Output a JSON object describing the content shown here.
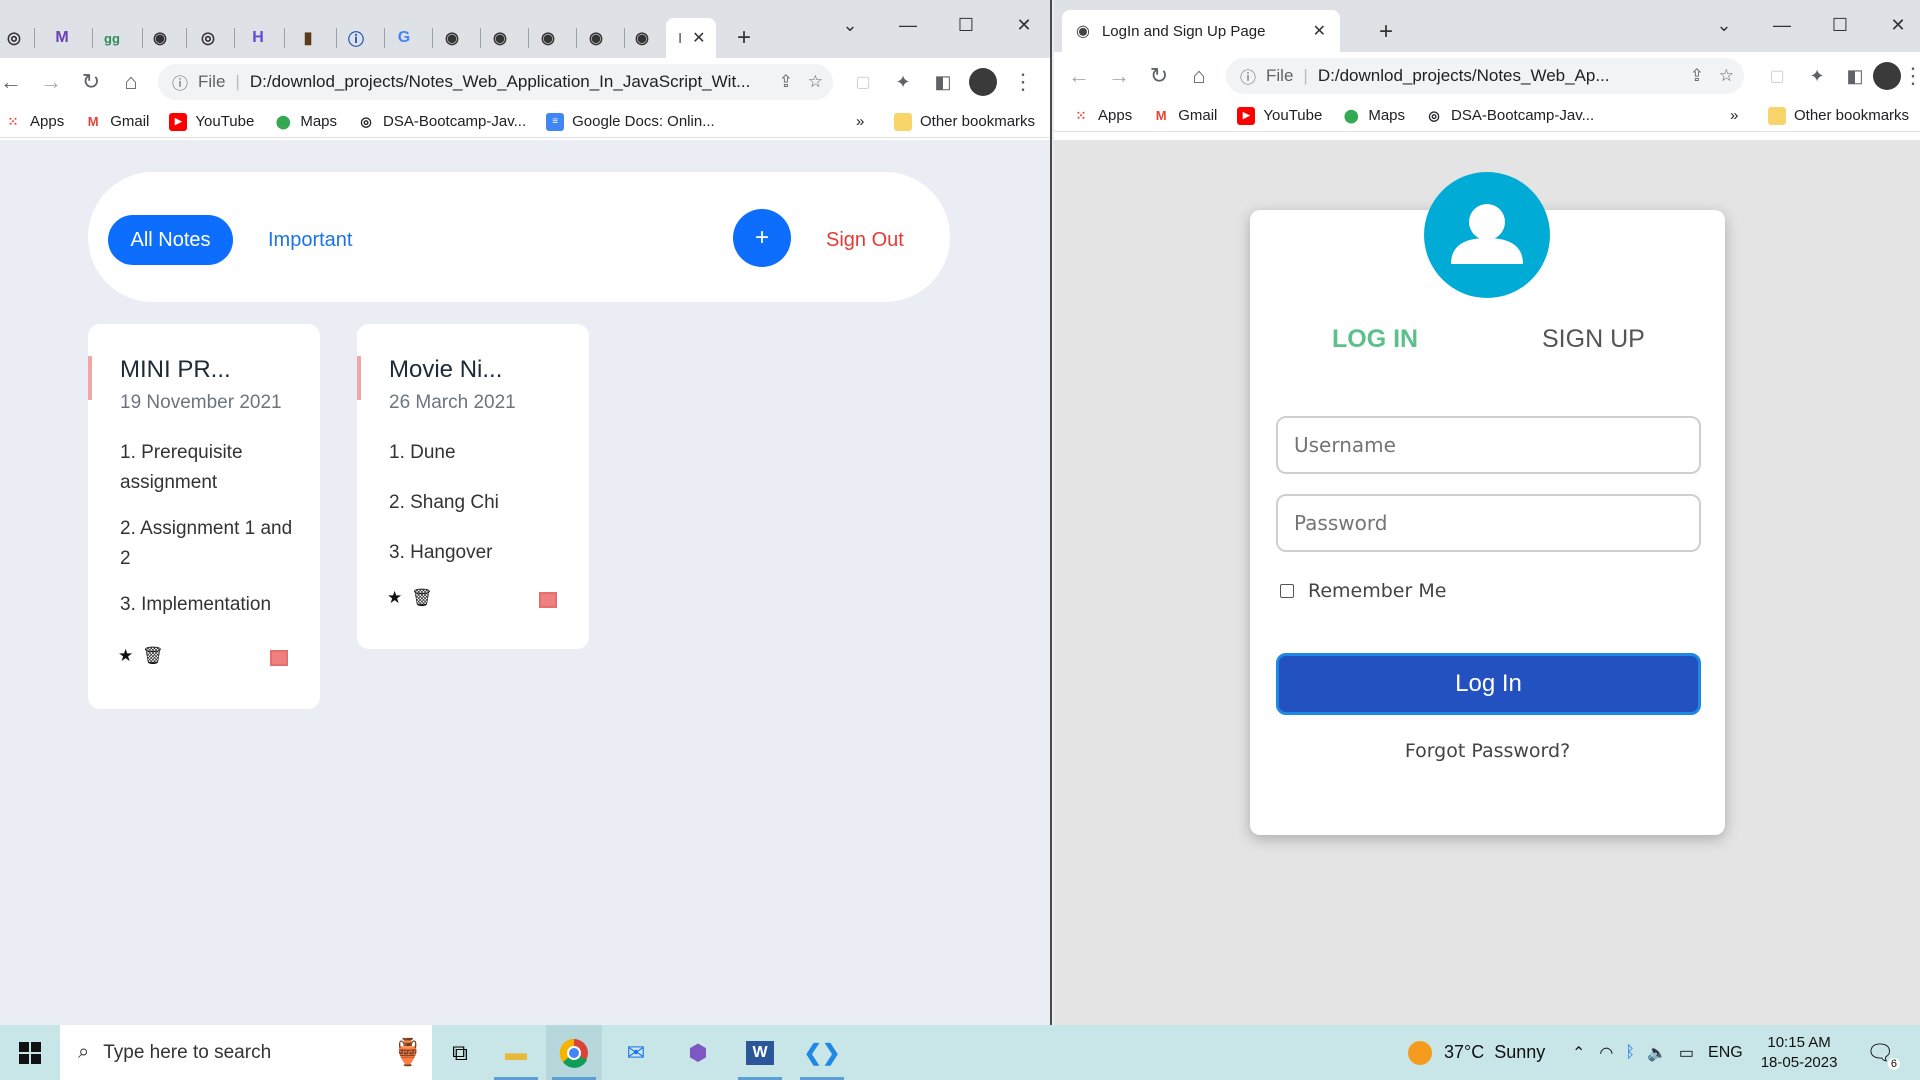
{
  "left_window": {
    "tab_short": "I",
    "address": "D:/downlod_projects/Notes_Web_Application_In_JavaScript_Wit...",
    "file_label": "File",
    "bookmarks": [
      {
        "label": "Apps",
        "icon": "apps-grid-icon"
      },
      {
        "label": "Gmail",
        "icon": "gmail-icon"
      },
      {
        "label": "YouTube",
        "icon": "youtube-icon"
      },
      {
        "label": "Maps",
        "icon": "maps-icon"
      },
      {
        "label": "DSA-Bootcamp-Jav...",
        "icon": "github-icon"
      },
      {
        "label": "Google Docs: Onlin...",
        "icon": "google-docs-icon"
      }
    ],
    "other_bookmarks": "Other bookmarks",
    "more": "»"
  },
  "notes_app": {
    "nav": {
      "all_notes": "All Notes",
      "important": "Important",
      "add": "+",
      "sign_out": "Sign Out"
    },
    "notes": [
      {
        "title": "MINI PR...",
        "date": "19 November 2021",
        "items": [
          "1. Prerequisite assignment",
          "2. Assignment 1 and 2",
          "3. Implementation"
        ]
      },
      {
        "title": "Movie Ni...",
        "date": "26 March 2021",
        "items": [
          "1. Dune",
          "2. Shang Chi",
          "3. Hangover"
        ]
      }
    ]
  },
  "right_window": {
    "tab_title": "LogIn and Sign Up Page",
    "file_label": "File",
    "address": "D:/downlod_projects/Notes_Web_Ap...",
    "bookmarks": [
      {
        "label": "Apps",
        "icon": "apps-grid-icon"
      },
      {
        "label": "Gmail",
        "icon": "gmail-icon"
      },
      {
        "label": "YouTube",
        "icon": "youtube-icon"
      },
      {
        "label": "Maps",
        "icon": "maps-icon"
      },
      {
        "label": "DSA-Bootcamp-Jav...",
        "icon": "github-icon"
      }
    ],
    "other_bookmarks": "Other bookmarks",
    "more": "»"
  },
  "login": {
    "tab_login": "LOG IN",
    "tab_signup": "SIGN UP",
    "username_placeholder": "Username",
    "password_placeholder": "Password",
    "remember": "Remember Me",
    "login_button": "Log In",
    "forgot": "Forgot Password?",
    "colors": {
      "active_tab": "#5cc08a",
      "button": "#2351c0",
      "avatar": "#00acd6"
    }
  },
  "taskbar": {
    "search_placeholder": "Type here to search",
    "weather": "37°C  Sunny",
    "lang": "ENG",
    "time": "10:15 AM",
    "date": "18-05-2023",
    "notification_count": "6"
  }
}
